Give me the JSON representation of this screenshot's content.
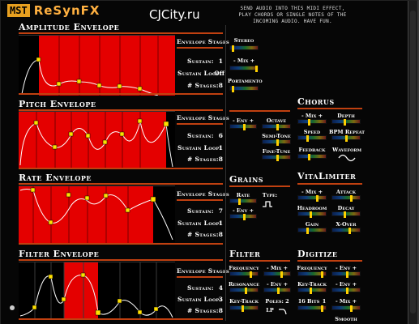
{
  "logo": {
    "badge": "MST",
    "name": "ReSynFX"
  },
  "watermark": "CJCity.ru",
  "description": "Send audio into this midi effect, play chords or single notes of the incoming audio. Have fun.",
  "envelopes": [
    {
      "title": "Amplitude Envelope",
      "stages_label": "Envelope Stages",
      "sustain_label": "Sustain:",
      "sustain_value": "1",
      "loop_label": "Sustain Loop:",
      "loop_value": "Off",
      "num_label": "# Stages:",
      "num_value": "8"
    },
    {
      "title": "Pitch Envelope",
      "stages_label": "Envelope Stages",
      "sustain_label": "Sustain:",
      "sustain_value": "6",
      "loop_label": "Sustain Loop:",
      "loop_value": "1",
      "num_label": "# Stages:",
      "num_value": "8"
    },
    {
      "title": "Rate Envelope",
      "stages_label": "Envelope Stages",
      "sustain_label": "Sustain:",
      "sustain_value": "7",
      "loop_label": "Sustain Loop:",
      "loop_value": "1",
      "num_label": "# Stages:",
      "num_value": "8"
    },
    {
      "title": "Filter Envelope",
      "stages_label": "Envelope Stages",
      "sustain_label": "Sustain:",
      "sustain_value": "4",
      "loop_label": "Sustain Loop:",
      "loop_value": "3",
      "num_label": "# Stages:",
      "num_value": "8"
    }
  ],
  "stereo": {
    "title": "Stereo",
    "mix": "- Mix +",
    "portamento": "Portamento"
  },
  "pitch_ctrl": {
    "env": "- Env +",
    "octave": "Octave",
    "semitone": "Semi-Tone",
    "finetune": "Fine-Tune"
  },
  "chorus": {
    "title": "Chorus",
    "mix": "- Mix +",
    "depth": "Depth",
    "speed": "Speed",
    "bpm": "BPM Repeat",
    "feedback": "Feedback",
    "waveform": "Waveform"
  },
  "grains": {
    "title": "Grains",
    "rate": "Rate",
    "type": "Type:",
    "env": "- Env +"
  },
  "vitalimiter": {
    "title": "VitaLimiter",
    "mix": "- Mix +",
    "attack": "Attack",
    "headroom": "Headroom",
    "decay": "Decay",
    "gain": "Gain",
    "xover": "X-Over"
  },
  "filter": {
    "title": "Filter",
    "frequency": "Frequency",
    "mix": "- Mix +",
    "resonance": "Resonance",
    "env": "- Env +",
    "keytrack": "Key-Track",
    "poles_label": "Poles: 2",
    "lp": "LP"
  },
  "digitize": {
    "title": "Digitize",
    "frequency": "Frequency",
    "env": "- Env +",
    "keytrack": "Key-Track",
    "env2": "- Env +",
    "bits": "16 Bits",
    "bits_val": "1",
    "mix": "- Mix +",
    "smooth": "Smooth"
  }
}
